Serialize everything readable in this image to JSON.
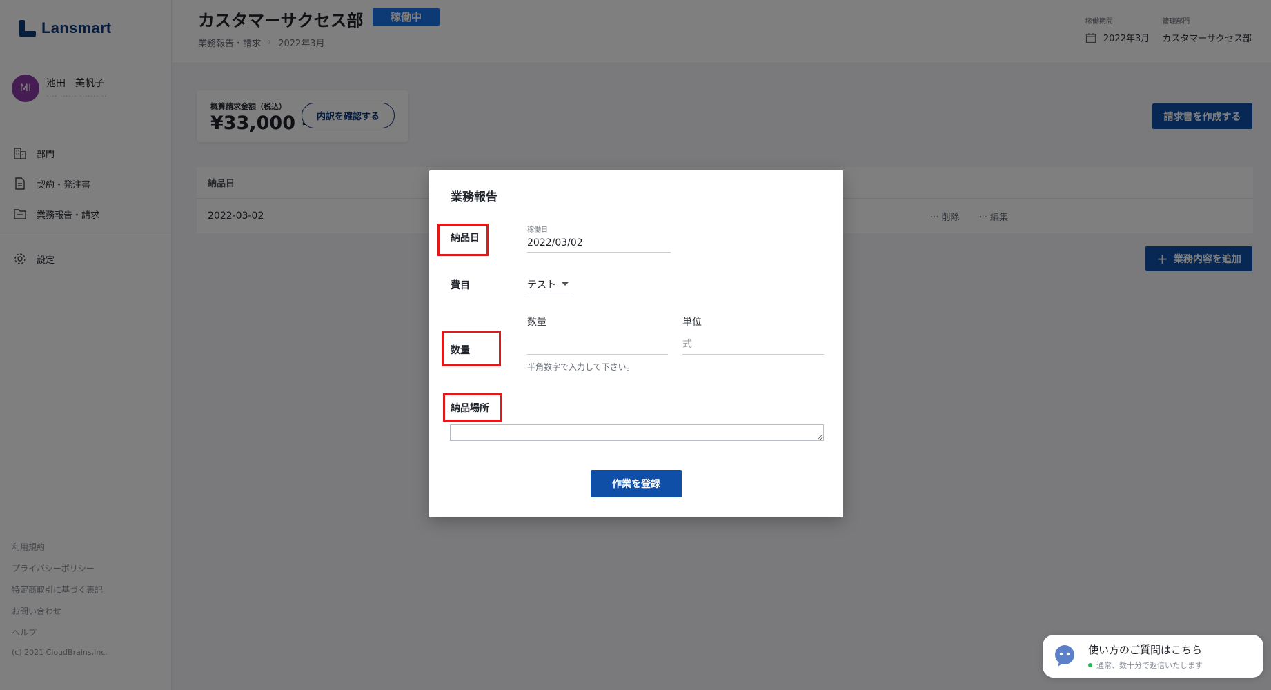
{
  "app": {
    "logo_text": "Lansmart",
    "brand_color": "#0e3a7c",
    "primary_color": "#0f4fa8"
  },
  "user": {
    "initials": "MI",
    "name": "池田　美帆子",
    "email": ""
  },
  "sidebar": {
    "items": [
      {
        "label": "部門",
        "icon": "building-icon"
      },
      {
        "label": "契約・発注書",
        "icon": "document-icon"
      },
      {
        "label": "業務報告・請求",
        "icon": "folder-icon"
      },
      {
        "label": "設定",
        "icon": "gear-icon"
      }
    ],
    "footer_links": [
      "利用規約",
      "プライバシーポリシー",
      "特定商取引に基づく表記",
      "お問い合わせ",
      "ヘルプ"
    ],
    "copyright": "(c) 2021 CloudBrains,Inc."
  },
  "header": {
    "title": "カスタマーサクセス部",
    "status": "稼働中",
    "status_color": "#1a73e8",
    "breadcrumb": [
      "業務報告・請求",
      "2022年3月"
    ],
    "period_label": "稼働期間",
    "period_value": "2022年3月",
    "dept_label": "管理部門",
    "dept_value": "カスタマーサクセス部"
  },
  "summary": {
    "label": "概算請求金額（税込）",
    "amount": "¥33,000 -",
    "breakdown_button": "内訳を確認する"
  },
  "actions": {
    "create_invoice": "請求書を作成する",
    "add_work": "業務内容を追加"
  },
  "table": {
    "header_date": "納品日",
    "rows": [
      {
        "date": "2022-03-02",
        "delete": "··· 削除",
        "edit": "··· 編集"
      }
    ]
  },
  "modal": {
    "title": "業務報告",
    "delivery_date_label": "納品日",
    "date_small_label": "稼働日",
    "date_value": "2022/03/02",
    "expense_label": "費目",
    "expense_value": "テスト",
    "quantity_label": "数量",
    "quantity_field_label": "数量",
    "quantity_value": "",
    "unit_label": "単位",
    "unit_placeholder": "式",
    "helper_text": "半角数字で入力して下さい。",
    "place_label": "納品場所",
    "place_value": "",
    "submit": "作業を登録"
  },
  "highlight_color": "#e01a1a",
  "chat": {
    "title": "使い方のご質問はこちら",
    "subtitle": "通常、数十分で返信いたします"
  }
}
